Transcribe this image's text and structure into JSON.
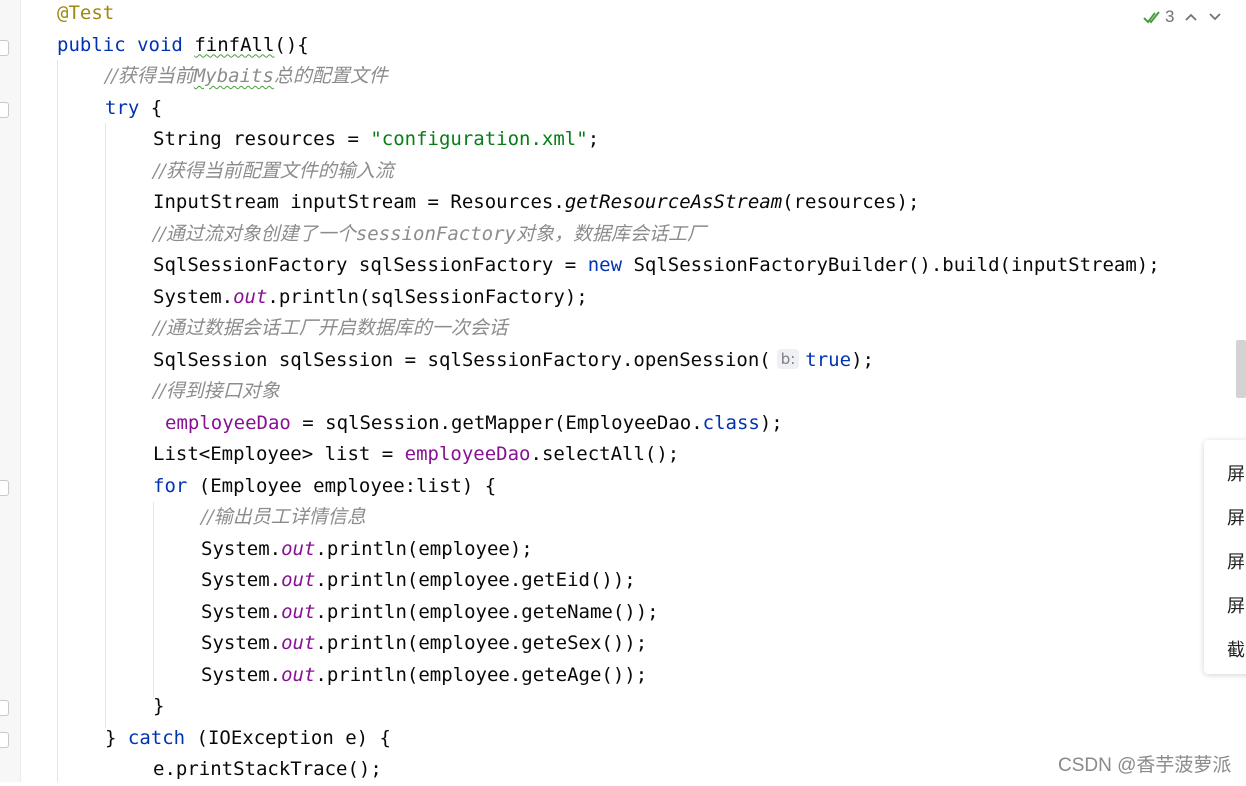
{
  "editor": {
    "lines": {
      "l1": {
        "annotation": "@Test"
      },
      "l2": {
        "kw_public": "public",
        "kw_void": "void",
        "method_name": "finfAll",
        "rest": "(){"
      },
      "l3": {
        "comment_a": "//获得当前",
        "comment_b": "Mybaits",
        "comment_c": "总的配置文件"
      },
      "l4": {
        "kw_try": "try",
        "rest": " {"
      },
      "l5": {
        "a": "String resources = ",
        "str": "\"configuration.xml\"",
        "b": ";"
      },
      "l6": {
        "comment": "//获得当前配置文件的输入流"
      },
      "l7": {
        "a": "InputStream inputStream = Resources.",
        "method": "getResourceAsStream",
        "b": "(resources);"
      },
      "l8": {
        "comment_a": "//通过流对象创建了一个",
        "comment_b": "sessionFactory",
        "comment_c": "对象，数据库会话工厂"
      },
      "l9": {
        "a": "SqlSessionFactory sqlSessionFactory = ",
        "kw_new": "new",
        "b": " SqlSessionFactoryBuilder().build(inputStream);"
      },
      "l10": {
        "a": "System.",
        "out": "out",
        "b": ".println(sqlSessionFactory);"
      },
      "l11": {
        "comment": "//通过数据会话工厂开启数据库的一次会话"
      },
      "l12": {
        "a": "SqlSession sqlSession = sqlSessionFactory.openSession(",
        "hint": "b:",
        "kw_true": "true",
        "b": ");"
      },
      "l13": {
        "comment": "//得到接口对象"
      },
      "l14": {
        "field": "employeeDao",
        "a": " = sqlSession.getMapper(EmployeeDao.",
        "kw_class": "class",
        "b": ");"
      },
      "l15": {
        "a": "List<Employee> list = ",
        "field": "employeeDao",
        "b": ".selectAll();"
      },
      "l16": {
        "kw_for": "for",
        "rest": " (Employee employee:list) {"
      },
      "l17": {
        "comment": "//输出员工详情信息"
      },
      "l18": {
        "a": "System.",
        "out": "out",
        "b": ".println(employee);"
      },
      "l19": {
        "a": "System.",
        "out": "out",
        "b": ".println(employee.getEid());"
      },
      "l20": {
        "a": "System.",
        "out": "out",
        "b": ".println(employee.geteName());"
      },
      "l21": {
        "a": "System.",
        "out": "out",
        "b": ".println(employee.geteSex());"
      },
      "l22": {
        "a": "System.",
        "out": "out",
        "b": ".println(employee.geteAge());"
      },
      "l23": {
        "rest": "}"
      },
      "l24": {
        "a": "} ",
        "kw_catch": "catch",
        "b": " (IOException e) {"
      },
      "l25": {
        "rest": "e.printStackTrace();"
      }
    }
  },
  "inspection": {
    "icon": "double-check-icon",
    "count": "3",
    "up_icon": "chevron-up-icon",
    "down_icon": "chevron-down-icon",
    "color": "#4a9e3f"
  },
  "context_menu": {
    "items": [
      "屏",
      "屏",
      "屏",
      "屏",
      "截"
    ]
  },
  "watermark": "CSDN @香芋菠萝派",
  "colors": {
    "keyword": "#0033b3",
    "string": "#067d17",
    "comment": "#8c8c8c",
    "annotation": "#9e880d",
    "field": "#871094"
  }
}
